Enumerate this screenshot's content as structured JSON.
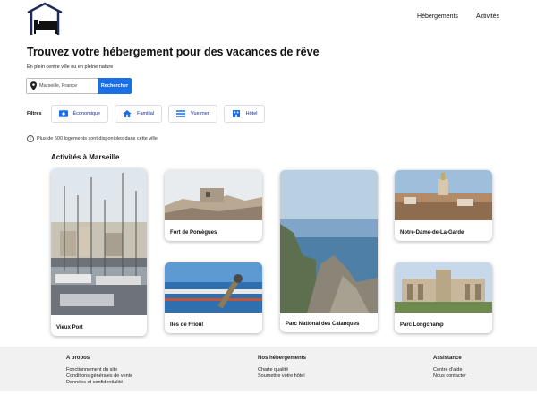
{
  "header": {
    "nav": [
      "Hébergements",
      "Activités"
    ]
  },
  "hero": {
    "title": "Trouvez votre hébergement pour des vacances de rêve",
    "subtitle": "En plein centre ville ou en pleine nature"
  },
  "search": {
    "value": "Marseille, France",
    "button": "Rechercher"
  },
  "filters": {
    "label": "Filtres",
    "chips": [
      {
        "label": "Économique",
        "icon": "money-icon"
      },
      {
        "label": "Familial",
        "icon": "home-icon"
      },
      {
        "label": "Vue mer",
        "icon": "waves-icon"
      },
      {
        "label": "Hôtel",
        "icon": "hotel-icon"
      }
    ]
  },
  "info": {
    "text": "Plus de 500 logements sont disponibles dans cette ville"
  },
  "activities": {
    "title": "Activités à Marseille",
    "cards": [
      {
        "label": "Vieux Port"
      },
      {
        "label": "Fort de Pomègues"
      },
      {
        "label": "Iles de Frioul"
      },
      {
        "label": "Parc National des Calanques"
      },
      {
        "label": "Notre-Dame-de-La-Garde"
      },
      {
        "label": "Parc Longchamp"
      }
    ]
  },
  "footer": {
    "about": {
      "title": "A propos",
      "links": [
        "Fonctionnement du site",
        "Conditions générales de vente",
        "Données et confidentialité"
      ]
    },
    "hosting": {
      "title": "Nos hébergements",
      "links": [
        "Charte qualité",
        "Soumettre votre hôtel"
      ]
    },
    "help": {
      "title": "Assistance",
      "links": [
        "Centre d'aide",
        "Nous contacter"
      ]
    }
  },
  "colors": {
    "accent": "#1a6fe6",
    "chip_text": "#1d2b8f",
    "footer_bg": "#f1f1f1",
    "logo": "#1d2b5c"
  }
}
